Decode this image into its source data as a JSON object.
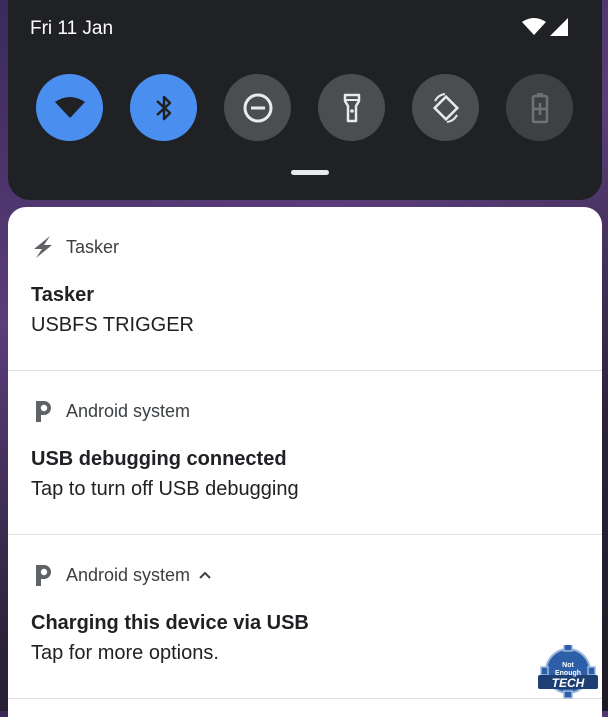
{
  "status": {
    "date": "Fri 11 Jan"
  },
  "quick_settings": {
    "tiles": [
      {
        "name": "wifi",
        "state": "on",
        "icon": "wifi-icon"
      },
      {
        "name": "bluetooth",
        "state": "on",
        "icon": "bluetooth-icon"
      },
      {
        "name": "do-not-disturb",
        "state": "off",
        "icon": "do-not-disturb-icon"
      },
      {
        "name": "flashlight",
        "state": "off",
        "icon": "flashlight-icon"
      },
      {
        "name": "auto-rotate",
        "state": "off",
        "icon": "auto-rotate-icon"
      },
      {
        "name": "battery-saver",
        "state": "disabled",
        "icon": "battery-saver-icon"
      }
    ],
    "colors": {
      "on": "#4a8ff0",
      "off": "#4b4d50"
    }
  },
  "notifications": [
    {
      "app": "Tasker",
      "title": "Tasker",
      "text": "USBFS TRIGGER",
      "icon": "tasker-bolt-icon"
    },
    {
      "app": "Android system",
      "title": "USB debugging connected",
      "text": "Tap to turn off USB debugging",
      "icon": "android-system-icon"
    },
    {
      "app": "Android system",
      "title": "Charging this device via USB",
      "text": "Tap for more options.",
      "icon": "android-system-icon",
      "expanded": true
    }
  ],
  "watermark": {
    "lines": [
      "Not",
      "Enough",
      "TECH"
    ]
  }
}
